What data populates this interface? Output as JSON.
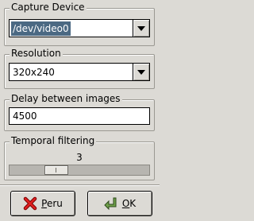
{
  "capture_device": {
    "legend": "Capture Device",
    "value": "/dev/video0"
  },
  "resolution": {
    "legend": "Resolution",
    "value": "320x240"
  },
  "delay": {
    "legend": "Delay between images",
    "value": "4500"
  },
  "temporal_filtering": {
    "legend": "Temporal filtering",
    "value": "3",
    "level_fraction": 0.3
  },
  "buttons": {
    "cancel": {
      "first": "P",
      "rest": "eru",
      "icon": "red-x-icon"
    },
    "ok": {
      "first": "O",
      "rest": "K",
      "icon": "green-arrow-icon"
    }
  },
  "colors": {
    "selection": "#4b6983",
    "background": "#dcdad5"
  }
}
